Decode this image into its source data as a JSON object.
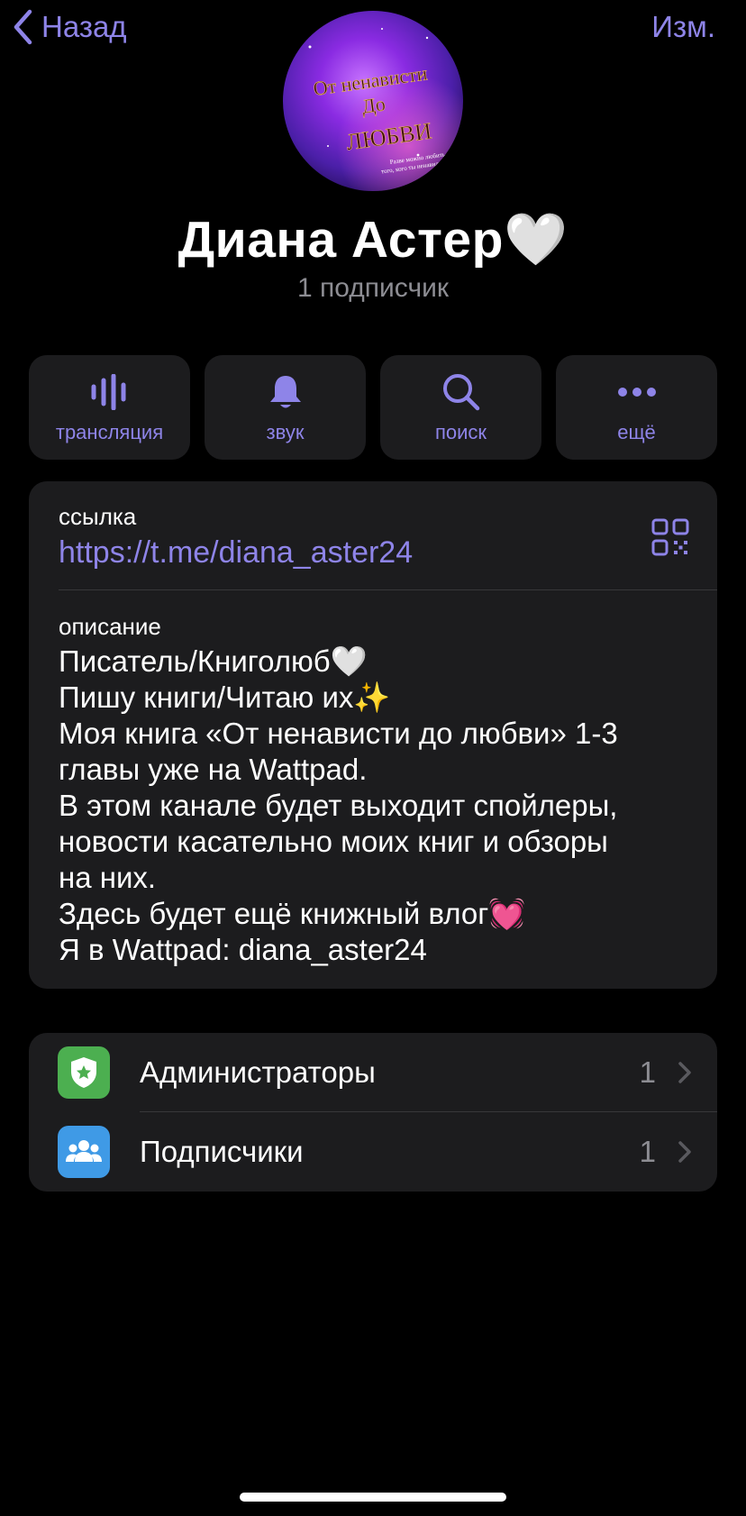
{
  "nav": {
    "back_label": "Назад",
    "edit_label": "Изм."
  },
  "avatar": {
    "line1": "От ненависти",
    "line2": "До",
    "line3": "ЛЮБВИ",
    "tagline1": "Разве можно любить",
    "tagline2": "того, кого ты ненавидишь?"
  },
  "channel": {
    "title": "Диана Астер🤍",
    "subtitle": "1 подписчик"
  },
  "actions": [
    {
      "label": "трансляция",
      "icon": "broadcast-icon"
    },
    {
      "label": "звук",
      "icon": "bell-icon"
    },
    {
      "label": "поиск",
      "icon": "search-icon"
    },
    {
      "label": "ещё",
      "icon": "more-icon"
    }
  ],
  "info": {
    "link_label": "ссылка",
    "link_value": "https://t.me/diana_aster24",
    "description_label": "описание",
    "description_lines": [
      "Писатель/Книголюб🤍",
      "Пишу книги/Читаю их✨",
      "Моя книга «От ненависти до любви» 1-3",
      "главы уже на Wattpad.",
      "В этом канале будет выходит спойлеры,",
      "новости касательно моих книг и обзоры",
      "на них.",
      "Здесь будет ещё книжный влог💓",
      "Я в Wattpad: diana_aster24"
    ]
  },
  "members": [
    {
      "label": "Администраторы",
      "count": "1",
      "icon": "admin-shield-icon",
      "color": "#4caf50"
    },
    {
      "label": "Подписчики",
      "count": "1",
      "icon": "subscribers-icon",
      "color": "#3f9ae6"
    }
  ],
  "colors": {
    "accent": "#8e84e8",
    "background": "#000000",
    "card": "#1c1c1e",
    "secondary_text": "#8d8d93"
  }
}
